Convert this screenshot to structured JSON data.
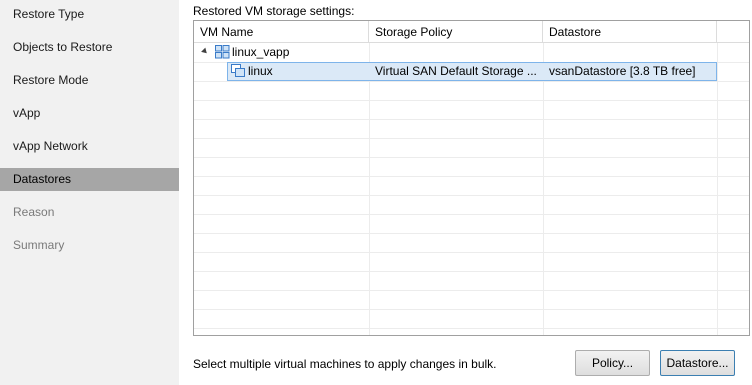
{
  "sidebar": {
    "steps": [
      {
        "label": "Restore Type",
        "state": "normal"
      },
      {
        "label": "Objects to Restore",
        "state": "normal"
      },
      {
        "label": "Restore Mode",
        "state": "normal"
      },
      {
        "label": "vApp",
        "state": "normal"
      },
      {
        "label": "vApp Network",
        "state": "normal"
      },
      {
        "label": "Datastores",
        "state": "active"
      },
      {
        "label": "Reason",
        "state": "disabled"
      },
      {
        "label": "Summary",
        "state": "disabled"
      }
    ]
  },
  "main": {
    "section_title": "Restored VM storage settings:",
    "columns": [
      "VM Name",
      "Storage Policy",
      "Datastore"
    ],
    "rows": [
      {
        "vm_name": "linux_vapp",
        "storage_policy": "",
        "datastore": "",
        "type": "vapp",
        "expanded": true
      },
      {
        "vm_name": "linux",
        "storage_policy": "Virtual SAN Default Storage ...",
        "datastore": "vsanDatastore [3.8 TB free]",
        "type": "vm",
        "selected": true
      }
    ],
    "hint": "Select multiple virtual machines to apply changes in bulk.",
    "buttons": {
      "policy": "Policy...",
      "datastore": "Datastore..."
    }
  },
  "colors": {
    "sidebar_bg": "#f1f1f1",
    "active_step_bg": "#a6a6a6",
    "disabled_text": "#7a7a7a",
    "selection_bg": "#dbe9f7",
    "selection_border": "#7eb4ea",
    "icon_blue": "#3a7bc8"
  },
  "icons": {
    "vapp": "vapp-icon",
    "vm": "vm-icon",
    "expander": "tree-expand-icon"
  }
}
